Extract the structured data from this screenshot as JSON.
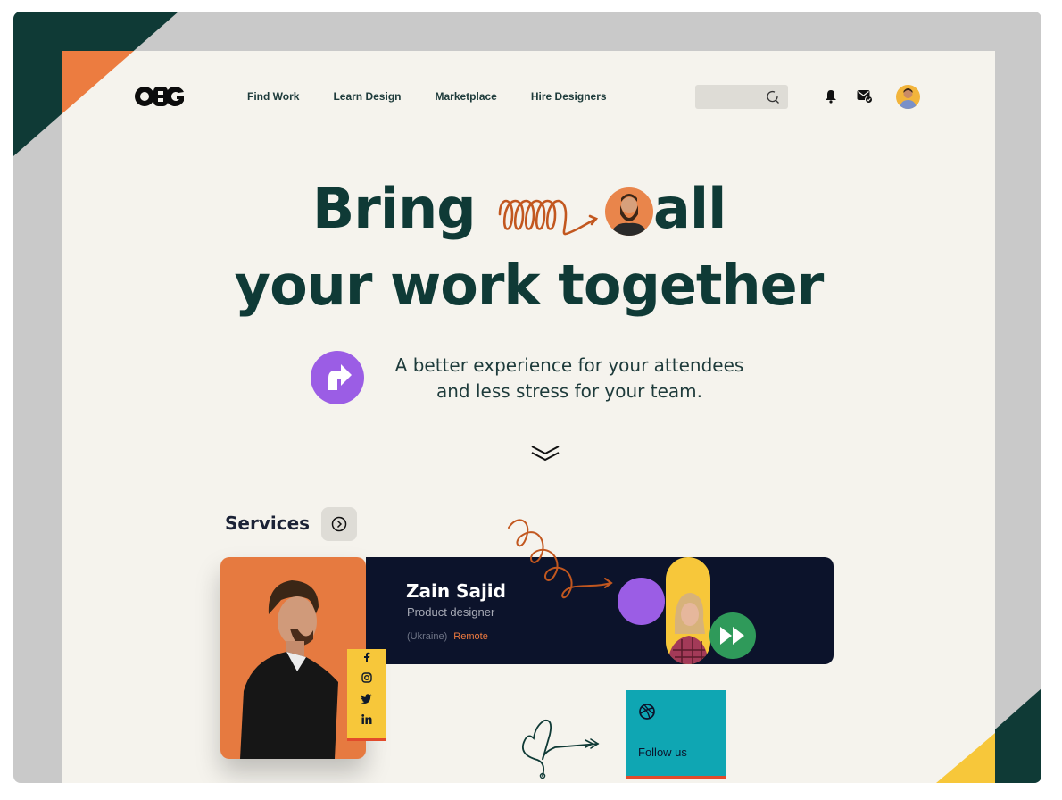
{
  "brand": {
    "logo_text": "OBG"
  },
  "nav": {
    "items": [
      {
        "label": "Find Work"
      },
      {
        "label": "Learn Design"
      },
      {
        "label": "Marketplace"
      },
      {
        "label": "Hire Designers"
      }
    ]
  },
  "header_icons": [
    "search-icon",
    "bell-icon",
    "mail-icon",
    "user-avatar"
  ],
  "hero": {
    "line1_part1": "Bring",
    "line1_part2": "all",
    "line2": "your work together",
    "subtitle_line1": "A better experience for your attendees",
    "subtitle_line2": "and less stress for your team."
  },
  "services": {
    "title": "Services",
    "card": {
      "name": "Zain Sajid",
      "role": "Product designer",
      "location": "(Ukraine)",
      "work_mode": "Remote"
    },
    "social": [
      "f",
      "ig",
      "tw",
      "in"
    ],
    "follow_label": "Follow us"
  },
  "colors": {
    "dark_green": "#0f3a36",
    "orange": "#ec7c40",
    "yellow": "#f7c73a",
    "purple": "#9b5de5",
    "navy": "#0c132b",
    "teal": "#0fa6b3",
    "green": "#2f9a5a",
    "background": "#f5f3ed"
  }
}
